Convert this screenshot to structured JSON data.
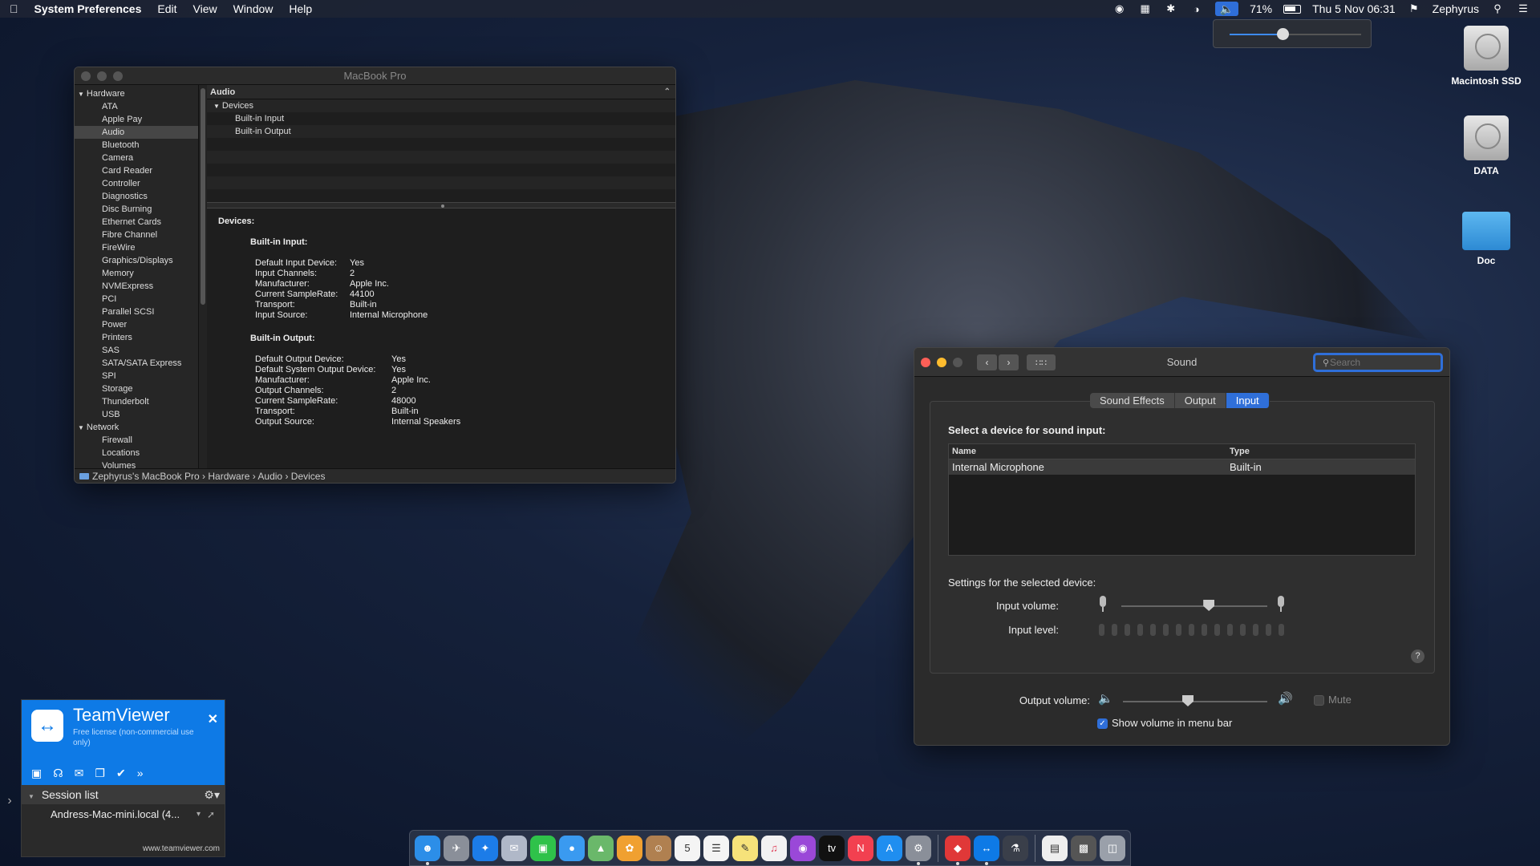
{
  "menubar": {
    "app_name": "System Preferences",
    "menus": [
      "Edit",
      "View",
      "Window",
      "Help"
    ],
    "battery": "71%",
    "clock": "Thu 5 Nov  06:31",
    "user": "Zephyrus"
  },
  "desktop_icons": [
    "Macintosh SSD",
    "DATA",
    "Doc"
  ],
  "sysinfo": {
    "title": "MacBook Pro",
    "hardware_label": "Hardware",
    "hardware_items": [
      "ATA",
      "Apple Pay",
      "Audio",
      "Bluetooth",
      "Camera",
      "Card Reader",
      "Controller",
      "Diagnostics",
      "Disc Burning",
      "Ethernet Cards",
      "Fibre Channel",
      "FireWire",
      "Graphics/Displays",
      "Memory",
      "NVMExpress",
      "PCI",
      "Parallel SCSI",
      "Power",
      "Printers",
      "SAS",
      "SATA/SATA Express",
      "SPI",
      "Storage",
      "Thunderbolt",
      "USB"
    ],
    "network_label": "Network",
    "network_items": [
      "Firewall",
      "Locations",
      "Volumes"
    ],
    "list_header": "Audio",
    "devices_group": "Devices",
    "device_rows": [
      "Built-in Input",
      "Built-in Output"
    ],
    "detail_heading": "Devices:",
    "input_heading": "Built-in Input:",
    "input_props": [
      [
        "Default Input Device:",
        "Yes"
      ],
      [
        "Input Channels:",
        "2"
      ],
      [
        "Manufacturer:",
        "Apple Inc."
      ],
      [
        "Current SampleRate:",
        "44100"
      ],
      [
        "Transport:",
        "Built-in"
      ],
      [
        "Input Source:",
        "Internal Microphone"
      ]
    ],
    "output_heading": "Built-in Output:",
    "output_props": [
      [
        "Default Output Device:",
        "Yes"
      ],
      [
        "Default System Output Device:",
        "Yes"
      ],
      [
        "Manufacturer:",
        "Apple Inc."
      ],
      [
        "Output Channels:",
        "2"
      ],
      [
        "Current SampleRate:",
        "48000"
      ],
      [
        "Transport:",
        "Built-in"
      ],
      [
        "Output Source:",
        "Internal Speakers"
      ]
    ],
    "path": [
      "Zephyrus's MacBook Pro",
      "Hardware",
      "Audio",
      "Devices"
    ]
  },
  "sound": {
    "title": "Sound",
    "search_placeholder": "Search",
    "tabs": [
      "Sound Effects",
      "Output",
      "Input"
    ],
    "active_tab": "Input",
    "select_label": "Select a device for sound input:",
    "col_name": "Name",
    "col_type": "Type",
    "device_name": "Internal Microphone",
    "device_type": "Built-in",
    "settings_label": "Settings for the selected device:",
    "input_volume_label": "Input volume:",
    "input_volume": 0.6,
    "input_level_label": "Input level:",
    "output_volume_label": "Output volume:",
    "output_volume": 0.45,
    "mute_label": "Mute",
    "mute_checked": false,
    "show_volume_label": "Show volume in menu bar",
    "show_volume_checked": true,
    "help": "?"
  },
  "menubar_volume": 0.4,
  "teamviewer": {
    "title": "TeamViewer",
    "subtitle": "Free license (non-commercial use only)",
    "session_list": "Session list",
    "host": "Andress-Mac-mini.local (4...",
    "url": "www.teamviewer.com"
  },
  "dock": {
    "accent": "#2f6fd9"
  }
}
